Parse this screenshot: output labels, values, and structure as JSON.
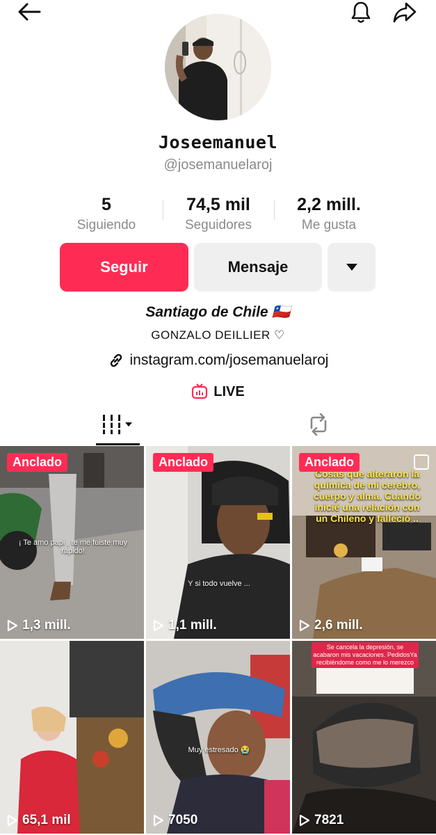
{
  "header": {
    "back_icon": "arrow-left-icon",
    "bell_icon": "bell-icon",
    "share_icon": "share-arrow-icon"
  },
  "profile": {
    "username": "Joseemanuel",
    "handle": "@josemanuelaroj",
    "stats": [
      {
        "value": "5",
        "label": "Siguiendo"
      },
      {
        "value": "74,5 mil",
        "label": "Seguidores"
      },
      {
        "value": "2,2 mill.",
        "label": "Me gusta"
      }
    ],
    "buttons": {
      "follow": "Seguir",
      "message": "Mensaje"
    },
    "bio": {
      "location": "Santiago de Chile 🇨🇱",
      "line2": "GONZALO DEILLIER ♡",
      "link": "instagram.com/josemanuelaroj",
      "live": "LIVE"
    }
  },
  "colors": {
    "accent": "#fe2c55",
    "muted": "#8a8a8a",
    "button_bg": "#efefef"
  },
  "videos": [
    {
      "pinned": "Anclado",
      "views": "1,3 mill.",
      "caption": "¡ Te amo papi , te me fuiste muy rápido!"
    },
    {
      "pinned": "Anclado",
      "views": "1,1 mill.",
      "caption": "Y si todo vuelve ..."
    },
    {
      "pinned": "Anclado",
      "views": "2,6 mill.",
      "caption": "Cosas que alteraron la química de mi cerebro, cuerpo y alma. Cuando inicié una relación con un Chileno y falleció .."
    },
    {
      "pinned": "",
      "views": "65,1 mil",
      "caption": ""
    },
    {
      "pinned": "",
      "views": "7050",
      "caption": "Muy estresado 😭"
    },
    {
      "pinned": "",
      "views": "7821",
      "caption": "Se cancela la depresión, se acabaron mis vacaciones. PedidosYa recibiéndome como me lo merezco"
    }
  ]
}
